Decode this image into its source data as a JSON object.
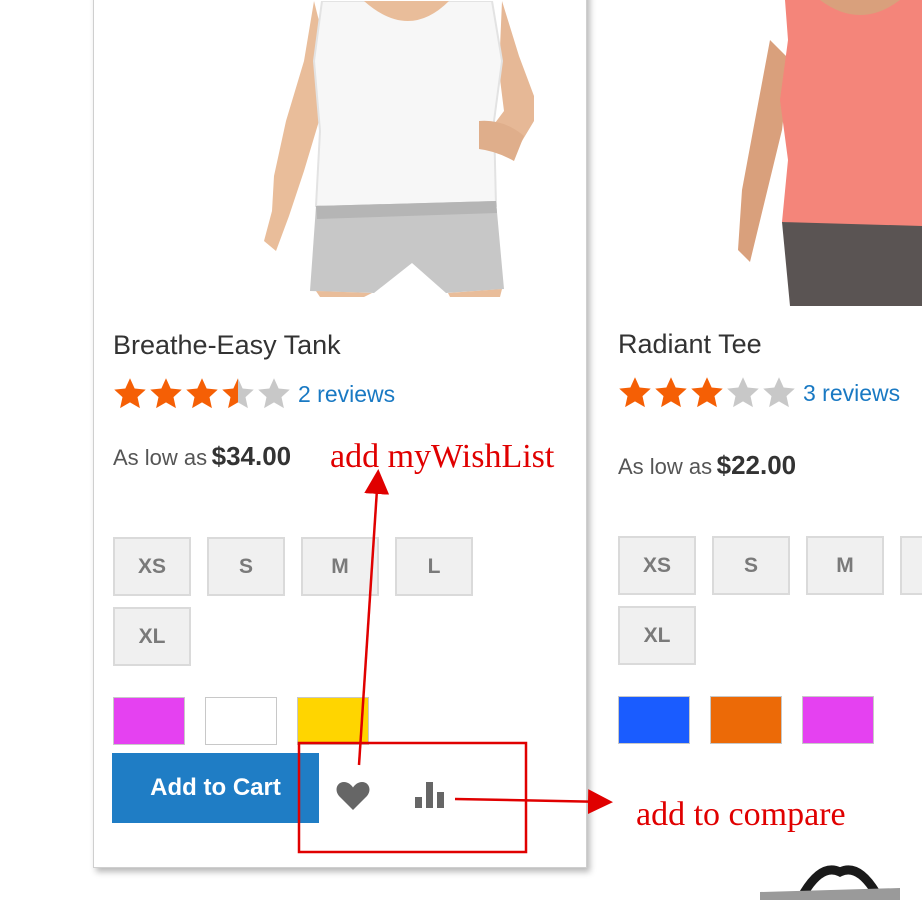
{
  "products": [
    {
      "name": "Breathe-Easy Tank",
      "rating_stars": 3.5,
      "reviews": "2 reviews",
      "price_label": "As low as",
      "price": "$34.00",
      "sizes": [
        "XS",
        "S",
        "M",
        "L",
        "XL"
      ],
      "swatch_colors": [
        "#e541f1",
        "#ffffff",
        "#ffd500"
      ],
      "add_to_cart_label": "Add to Cart"
    },
    {
      "name": "Radiant Tee",
      "rating_stars": 3,
      "reviews": "3 reviews",
      "price_label": "As low as",
      "price": "$22.00",
      "sizes": [
        "XS",
        "S",
        "M",
        "",
        "XL"
      ],
      "swatch_colors": [
        "#1a5cff",
        "#ec6a07",
        "#e541f1"
      ]
    }
  ],
  "annotations": {
    "wishlist": "add myWishList",
    "compare": "add to compare"
  },
  "colors": {
    "star_filled": "#f55f05",
    "star_empty": "#c8c8c8",
    "link": "#1979c3",
    "button": "#1f7dc5",
    "annotation": "#e00000"
  },
  "icons": {
    "wishlist": "heart-icon",
    "compare": "bar-chart-icon"
  }
}
